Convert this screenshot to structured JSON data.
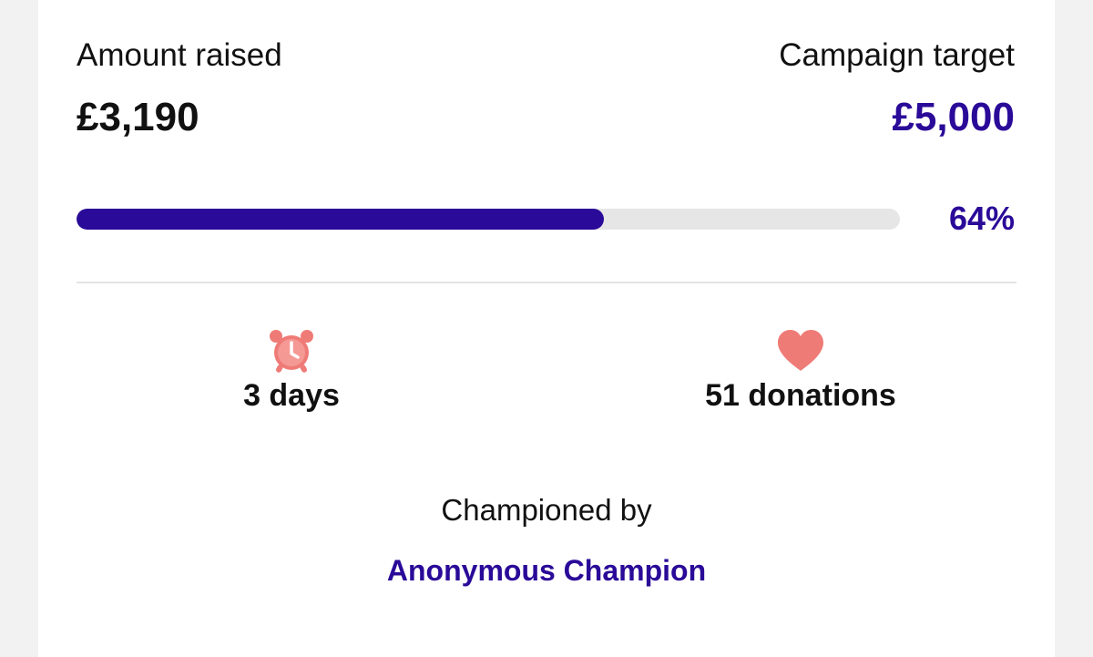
{
  "funding": {
    "raised_label": "Amount raised",
    "raised_value": "£3,190",
    "target_label": "Campaign target",
    "target_value": "£5,000",
    "progress_fraction": 0.64,
    "percent_text": "64%"
  },
  "stats": {
    "days_text": "3 days",
    "days_icon": "alarm-clock-icon",
    "donations_text": "51 donations",
    "donations_icon": "heart-icon"
  },
  "champion": {
    "label": "Championed by",
    "name": "Anonymous Champion"
  },
  "colors": {
    "accent": "#2a0a98",
    "icon": "#ef7b77",
    "track": "#e6e6e6",
    "text": "#111111",
    "background": "#f2f2f2",
    "card": "#ffffff"
  }
}
